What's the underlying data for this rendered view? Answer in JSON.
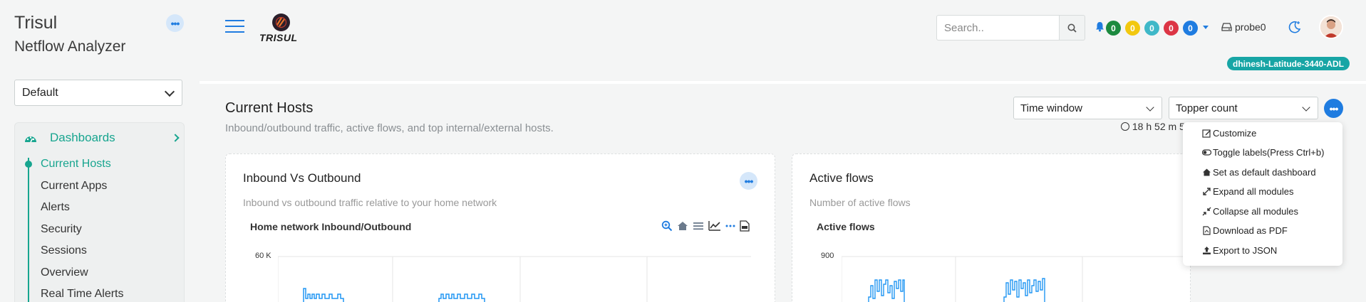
{
  "sidebar": {
    "app_name": "Trisul",
    "app_subtitle": "Netflow Analyzer",
    "context_select": "Default",
    "section": "Dashboards",
    "items": [
      {
        "label": "Current Hosts"
      },
      {
        "label": "Current Apps"
      },
      {
        "label": "Alerts"
      },
      {
        "label": "Security"
      },
      {
        "label": "Sessions"
      },
      {
        "label": "Overview"
      },
      {
        "label": "Real Time Alerts"
      }
    ]
  },
  "topbar": {
    "logo_text": "TRISUL",
    "search_placeholder": "Search..",
    "badges": [
      {
        "value": "0",
        "color": "#1c8a3f"
      },
      {
        "value": "0",
        "color": "#f2c80f"
      },
      {
        "value": "0",
        "color": "#3fb8c8"
      },
      {
        "value": "0",
        "color": "#dc3545"
      },
      {
        "value": "0",
        "color": "#1f7ce0"
      }
    ],
    "probe": "probe0",
    "hostname": "dhinesh-Latitude-3440-ADL"
  },
  "page": {
    "title": "Current Hosts",
    "description": "Inbound/outbound traffic, active flows, and top internal/external hosts.",
    "time_window": "Time window",
    "topper_count": "Topper count",
    "timer": "18 h 52 m 5"
  },
  "cards": [
    {
      "title": "Inbound Vs Outbound",
      "subtitle": "Inbound vs outbound traffic relative to your home network",
      "chart_title": "Home network Inbound/Outbound",
      "y_tick": "60 K"
    },
    {
      "title": "Active flows",
      "subtitle": "Number of active flows",
      "chart_title": "Active flows",
      "y_tick": "900"
    }
  ],
  "menu": [
    {
      "label": "Customize",
      "icon": "edit-icon"
    },
    {
      "label": "Toggle labels(Press Ctrl+b)",
      "icon": "toggle-icon"
    },
    {
      "label": "Set as default dashboard",
      "icon": "home-icon"
    },
    {
      "label": "Expand all modules",
      "icon": "expand-icon"
    },
    {
      "label": "Collapse all modules",
      "icon": "collapse-icon"
    },
    {
      "label": "Download as PDF",
      "icon": "pdf-icon"
    },
    {
      "label": "Export to JSON",
      "icon": "upload-icon"
    }
  ],
  "colors": {
    "accent": "#17a58f",
    "primary": "#1f7ce0",
    "chart_line": "#2196f3"
  }
}
